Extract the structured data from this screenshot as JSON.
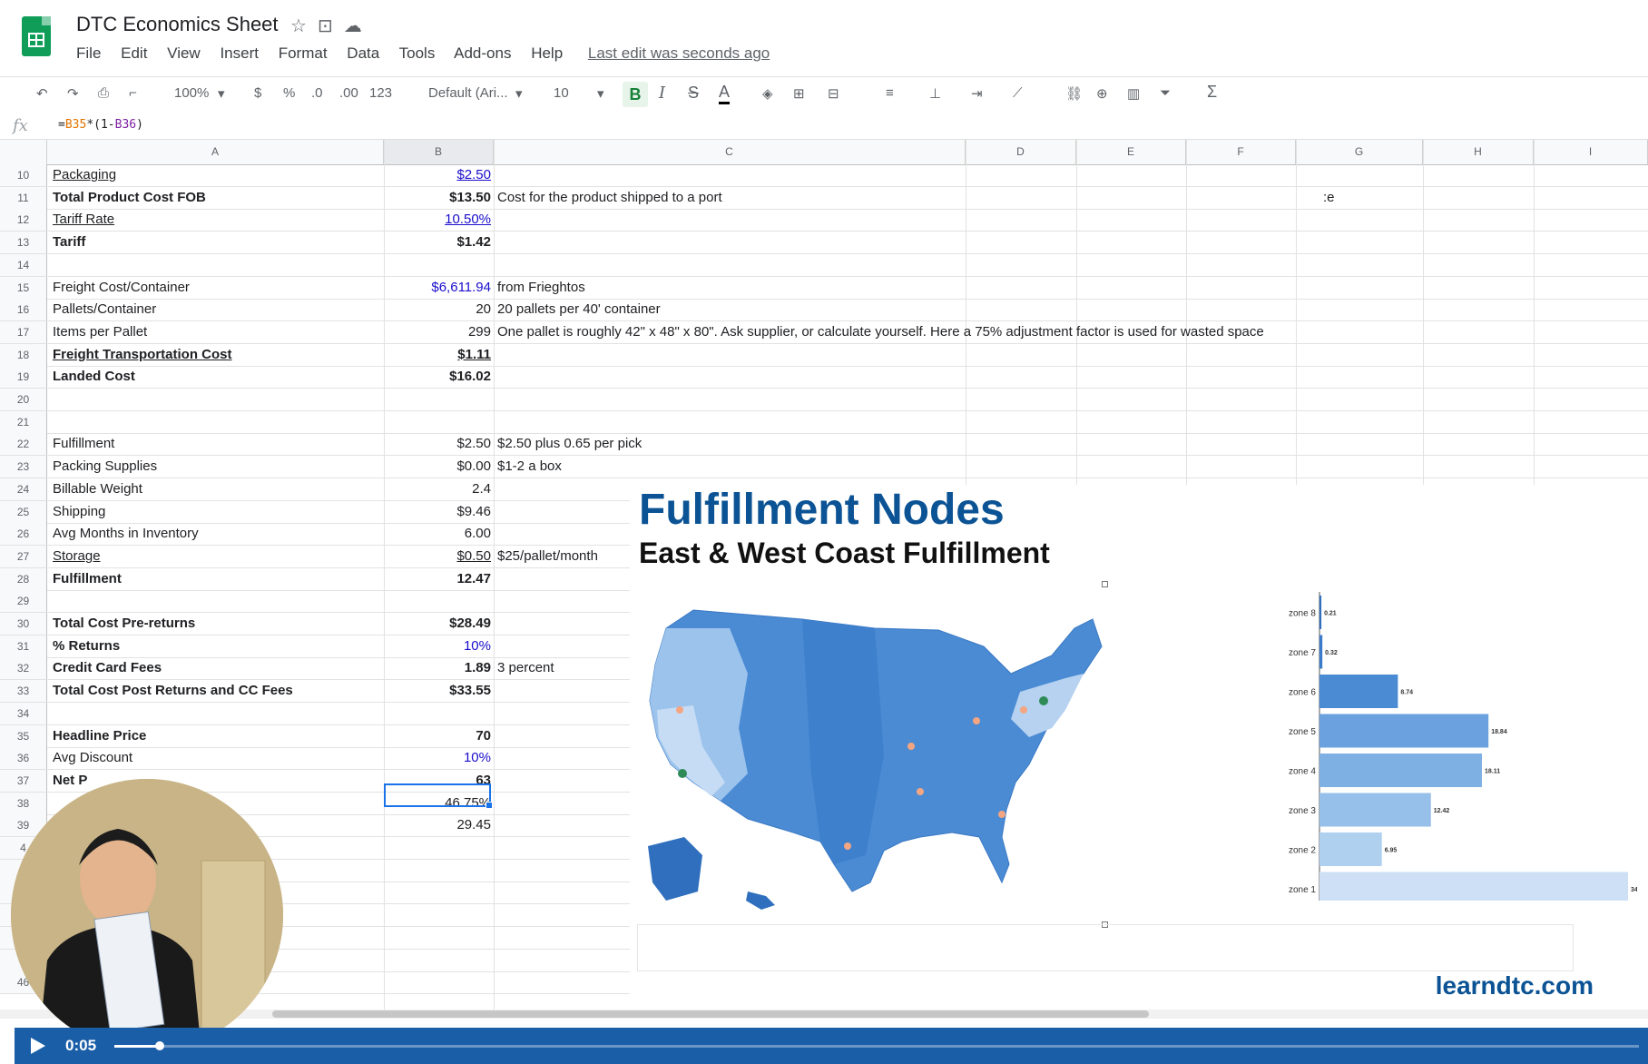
{
  "doc": {
    "title": "DTC Economics Sheet",
    "menu": [
      "File",
      "Edit",
      "View",
      "Insert",
      "Format",
      "Data",
      "Tools",
      "Add-ons",
      "Help"
    ],
    "last_edit": "Last edit was seconds ago"
  },
  "toolbar": {
    "zoom": "100%",
    "currency": "$",
    "percent": "%",
    "dec_less": ".0",
    "dec_more": ".00",
    "format_more": "123",
    "font": "Default (Ari...",
    "font_size": "10",
    "bold": "B",
    "italic": "I",
    "strike": "S",
    "text_color": "A",
    "sum": "Σ"
  },
  "formula": {
    "fx": "fx",
    "prefix": "=",
    "ref1": "B35",
    "mid": "*(1-",
    "ref2": "B36",
    "suffix": ")"
  },
  "columns": [
    "A",
    "B",
    "C",
    "D",
    "E",
    "F",
    "G",
    "H",
    "I"
  ],
  "rows": [
    {
      "n": "10",
      "a": "Packaging",
      "b": "$2.50",
      "c": ""
    },
    {
      "n": "11",
      "a": "Total Product Cost FOB",
      "b": "$13.50",
      "c": "Cost for the product shipped to a port",
      "g": ":e"
    },
    {
      "n": "12",
      "a": "Tariff Rate",
      "b": "10.50%",
      "c": ""
    },
    {
      "n": "13",
      "a": "Tariff",
      "b": "$1.42",
      "c": ""
    },
    {
      "n": "14",
      "a": "",
      "b": "",
      "c": ""
    },
    {
      "n": "15",
      "a": "Freight Cost/Container",
      "b": "$6,611.94",
      "c": "from Frieghtos"
    },
    {
      "n": "16",
      "a": "Pallets/Container",
      "b": "20",
      "c": "20 pallets per 40' container"
    },
    {
      "n": "17",
      "a": "Items per Pallet",
      "b": "299",
      "c": "One pallet is roughly 42\" x 48\" x 80\". Ask supplier, or calculate yourself. Here a 75% adjustment factor is used for wasted space"
    },
    {
      "n": "18",
      "a": "Freight Transportation Cost",
      "b": "$1.11",
      "c": ""
    },
    {
      "n": "19",
      "a": "Landed Cost",
      "b": "$16.02",
      "c": ""
    },
    {
      "n": "20",
      "a": "",
      "b": "",
      "c": ""
    },
    {
      "n": "21",
      "a": "",
      "b": "",
      "c": ""
    },
    {
      "n": "22",
      "a": "Fulfillment",
      "b": "$2.50",
      "c": "$2.50 plus 0.65 per pick"
    },
    {
      "n": "23",
      "a": "Packing Supplies",
      "b": "$0.00",
      "c": "$1-2 a box"
    },
    {
      "n": "24",
      "a": "Billable Weight",
      "b": "2.4",
      "c": ""
    },
    {
      "n": "25",
      "a": "Shipping",
      "b": "$9.46",
      "c": ""
    },
    {
      "n": "26",
      "a": "Avg Months in Inventory",
      "b": "6.00",
      "c": ""
    },
    {
      "n": "27",
      "a": "Storage",
      "b": "$0.50",
      "c": "$25/pallet/month"
    },
    {
      "n": "28",
      "a": "Fulfillment",
      "b": "12.47",
      "c": ""
    },
    {
      "n": "29",
      "a": "",
      "b": "",
      "c": ""
    },
    {
      "n": "30",
      "a": "Total Cost Pre-returns",
      "b": "$28.49",
      "c": ""
    },
    {
      "n": "31",
      "a": "% Returns",
      "b": "10%",
      "c": ""
    },
    {
      "n": "32",
      "a": "Credit Card Fees",
      "b": "1.89",
      "c": "3 percent"
    },
    {
      "n": "33",
      "a": "Total Cost Post Returns and CC Fees",
      "b": "$33.55",
      "c": ""
    },
    {
      "n": "34",
      "a": "",
      "b": "",
      "c": ""
    },
    {
      "n": "35",
      "a": "Headline Price",
      "b": "70",
      "c": ""
    },
    {
      "n": "36",
      "a": "Avg Discount",
      "b": "10%",
      "c": ""
    },
    {
      "n": "37",
      "a": "Net P",
      "b": "63",
      "c": ""
    },
    {
      "n": "38",
      "a": "",
      "b": "46.75%",
      "c": ""
    },
    {
      "n": "39",
      "a": "",
      "b": "29.45",
      "c": ""
    },
    {
      "n": "4",
      "a": "",
      "b": "",
      "c": ""
    },
    {
      "n": "4",
      "a": "",
      "b": "",
      "c": ""
    },
    {
      "n": "4",
      "a": "",
      "b": "",
      "c": ""
    },
    {
      "n": "4",
      "a": "",
      "b": "",
      "c": ""
    },
    {
      "n": "4",
      "a": "",
      "b": "",
      "c": ""
    },
    {
      "n": "4",
      "a": "",
      "b": "",
      "c": ""
    },
    {
      "n": "46",
      "a": "",
      "b": "",
      "c": ""
    }
  ],
  "overlay": {
    "title": "Fulfillment Nodes",
    "subtitle": "East & West Coast Fulfillment",
    "brand": "learndtc.com"
  },
  "chart_data": {
    "type": "bar",
    "orientation": "horizontal",
    "categories": [
      "zone 8",
      "zone 7",
      "zone 6",
      "zone 5",
      "zone 4",
      "zone 3",
      "zone 2",
      "zone 1"
    ],
    "values": [
      0.21,
      0.32,
      8.74,
      18.84,
      18.11,
      12.42,
      6.95,
      34.4
    ],
    "labels": [
      "0.21",
      "0.32",
      "8.74",
      "18.84",
      "18.11",
      "12.42",
      "6.95",
      "34."
    ],
    "colors": [
      "#2f6fbe",
      "#3a7cca",
      "#4a8bd4",
      "#6aa1de",
      "#7fb0e4",
      "#96bfe9",
      "#b0d0f0",
      "#cde0f6"
    ],
    "title": "",
    "xlabel": "",
    "ylabel": ""
  },
  "video": {
    "time": "0:05",
    "progress": 0.03
  },
  "colors": {
    "link_blue": "#1a0dcc",
    "brand_blue": "#0b5394",
    "selection": "#1a73e8",
    "video_bar": "#1b5ea8"
  }
}
